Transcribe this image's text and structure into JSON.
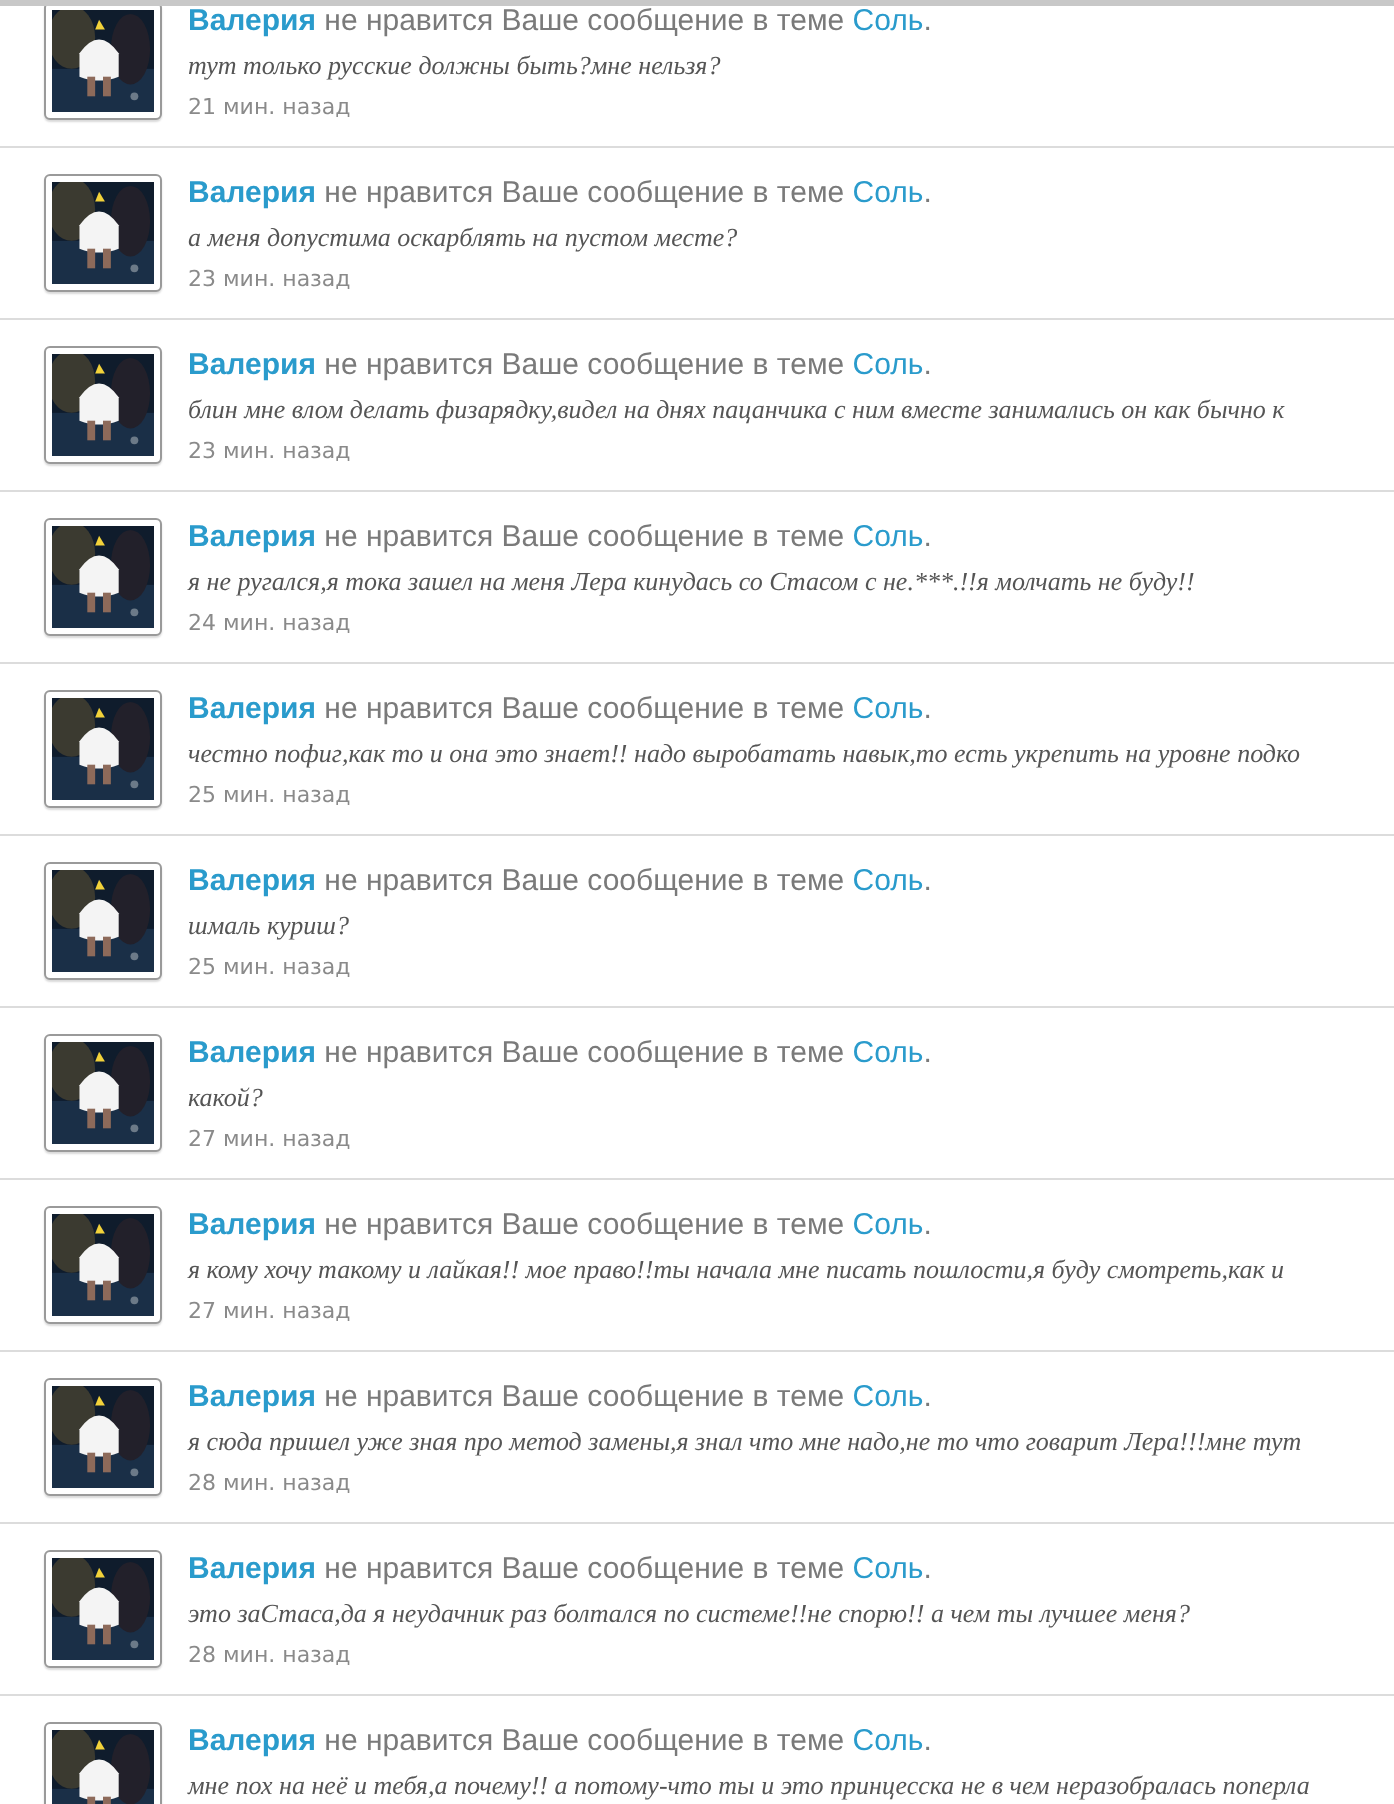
{
  "notifications": [
    {
      "user": "Валерия",
      "action": "не нравится Ваше сообщение в теме",
      "topic": "Соль",
      "end": ".",
      "message": "тут только русские должны быть?мне нельзя?",
      "time": "21 мин. назад"
    },
    {
      "user": "Валерия",
      "action": "не нравится Ваше сообщение в теме",
      "topic": "Соль",
      "end": ".",
      "message": "а меня допустима оскарблять на пустом месте?",
      "time": "23 мин. назад"
    },
    {
      "user": "Валерия",
      "action": "не нравится Ваше сообщение в теме",
      "topic": "Соль",
      "end": ".",
      "message": "блин мне влом делать физарядку,видел на днях пацанчика с ним вместе занимались он как бычно к",
      "time": "23 мин. назад"
    },
    {
      "user": "Валерия",
      "action": "не нравится Ваше сообщение в теме",
      "topic": "Соль",
      "end": ".",
      "message": "я не ругался,я тока зашел на меня Лера кинудась со Стасом с не.***.!!я молчать не буду!!",
      "time": "24 мин. назад"
    },
    {
      "user": "Валерия",
      "action": "не нравится Ваше сообщение в теме",
      "topic": "Соль",
      "end": ".",
      "message": "честно пофиг,как то и она это знает!! надо выробатать навык,то есть укрепить на уровне подко",
      "time": "25 мин. назад"
    },
    {
      "user": "Валерия",
      "action": "не нравится Ваше сообщение в теме",
      "topic": "Соль",
      "end": ".",
      "message": "шмаль куриш?",
      "time": "25 мин. назад"
    },
    {
      "user": "Валерия",
      "action": "не нравится Ваше сообщение в теме",
      "topic": "Соль",
      "end": ".",
      "message": "какой?",
      "time": "27 мин. назад"
    },
    {
      "user": "Валерия",
      "action": "не нравится Ваше сообщение в теме",
      "topic": "Соль",
      "end": ".",
      "message": "я кому хочу такому и лайкая!! мое право!!ты начала мне писать пошлости,я буду смотреть,как и",
      "time": "27 мин. назад"
    },
    {
      "user": "Валерия",
      "action": "не нравится Ваше сообщение в теме",
      "topic": "Соль",
      "end": ".",
      "message": "я сюда пришел уже зная про метод замены,я знал что мне надо,не то что говарит Лера!!!мне тут",
      "time": "28 мин. назад"
    },
    {
      "user": "Валерия",
      "action": "не нравится Ваше сообщение в теме",
      "topic": "Соль",
      "end": ".",
      "message": "это заСтаса,да я неудачник раз болтался по системе!!не спорю!! а чем ты лучшее меня?",
      "time": "28 мин. назад"
    },
    {
      "user": "Валерия",
      "action": "не нравится Ваше сообщение в теме",
      "topic": "Соль",
      "end": ".",
      "message": "мне пох на неё и тебя,а почему!! а потому-что ты и это принцесска не в чем неразобралась поперла"
    }
  ]
}
